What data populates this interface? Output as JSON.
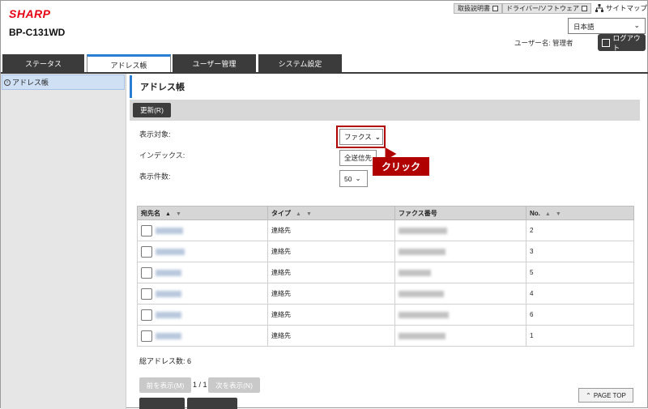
{
  "header": {
    "brand": "SHARP",
    "model": "BP-C131WD",
    "links": [
      "取扱説明書",
      "ドライバー/ソフトウェア"
    ],
    "sitemap": "サイトマップ",
    "language": "日本語",
    "user_label": "ユーザー名: 管理者",
    "logout": "ログアウト"
  },
  "tabs": [
    {
      "label": "ステータス"
    },
    {
      "label": "アドレス帳"
    },
    {
      "label": "ユーザー管理"
    },
    {
      "label": "システム設定"
    }
  ],
  "sidebar": {
    "items": [
      {
        "label": "アドレス帳"
      }
    ]
  },
  "main": {
    "title": "アドレス帳",
    "refresh_button": "更新(R)",
    "filters": {
      "display_target_label": "表示対象:",
      "display_target_value": "ファクス",
      "index_label": "インデックス:",
      "index_value": "全送信先",
      "count_label": "表示件数:",
      "count_value": "50"
    },
    "callout": "クリック",
    "table": {
      "columns": [
        "宛先名",
        "タイプ",
        "ファクス番号",
        "No."
      ],
      "rows": [
        {
          "type": "連絡先",
          "no": "2"
        },
        {
          "type": "連絡先",
          "no": "3"
        },
        {
          "type": "連絡先",
          "no": "5"
        },
        {
          "type": "連絡先",
          "no": "4"
        },
        {
          "type": "連絡先",
          "no": "6"
        },
        {
          "type": "連絡先",
          "no": "1"
        }
      ]
    },
    "total_label": "総アドレス数:",
    "total_value": "6",
    "pagination": {
      "prev": "前を表示(M)",
      "page": "1 / 1",
      "next": "次を表示(N)"
    },
    "page_top": "PAGE TOP"
  },
  "colors": {
    "accent": "#2a7dd1",
    "brand": "#e60012",
    "callout": "#b00000",
    "dark": "#3d3d3d"
  }
}
